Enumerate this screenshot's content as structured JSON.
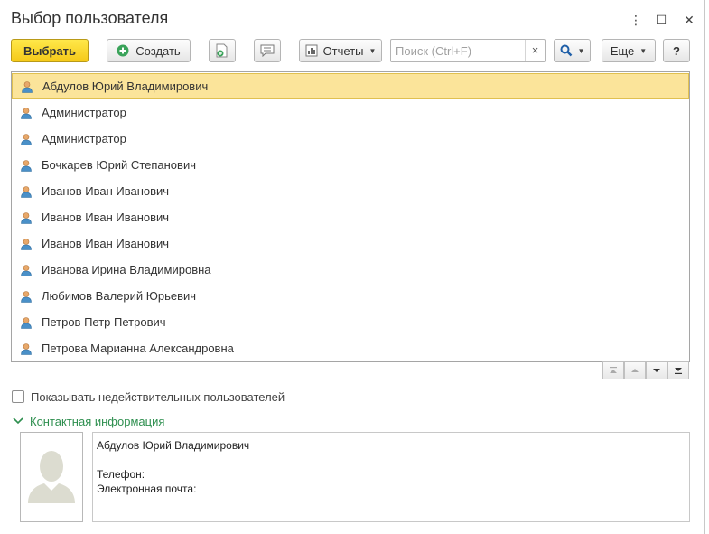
{
  "window": {
    "title": "Выбор пользователя",
    "menu_glyph": "⋮",
    "maximize_glyph": "☐",
    "close_glyph": "✕"
  },
  "toolbar": {
    "select_label": "Выбрать",
    "create_label": "Создать",
    "reports_label": "Отчеты",
    "search_placeholder": "Поиск (Ctrl+F)",
    "clear_glyph": "×",
    "more_label": "Еще",
    "help_label": "?"
  },
  "users": [
    {
      "name": "Абдулов Юрий Владимирович",
      "selected": true
    },
    {
      "name": "Администратор"
    },
    {
      "name": "Администратор"
    },
    {
      "name": "Бочкарев Юрий Степанович"
    },
    {
      "name": "Иванов Иван Иванович"
    },
    {
      "name": "Иванов Иван Иванович"
    },
    {
      "name": "Иванов Иван Иванович"
    },
    {
      "name": "Иванова Ирина Владимировна"
    },
    {
      "name": "Любимов Валерий Юрьевич"
    },
    {
      "name": "Петров Петр Петрович"
    },
    {
      "name": "Петрова Марианна Александровна"
    }
  ],
  "show_invalid": {
    "label": "Показывать недействительных пользователей",
    "checked": false
  },
  "contact_section": {
    "label": "Контактная информация",
    "expanded": true,
    "name": "Абдулов Юрий Владимирович",
    "phone_label": "Телефон:",
    "email_label": "Электронная почта:"
  },
  "colors": {
    "accent_yellow": "#f5c918",
    "selection": "#fbe49a",
    "section_green": "#2e8f4f"
  }
}
